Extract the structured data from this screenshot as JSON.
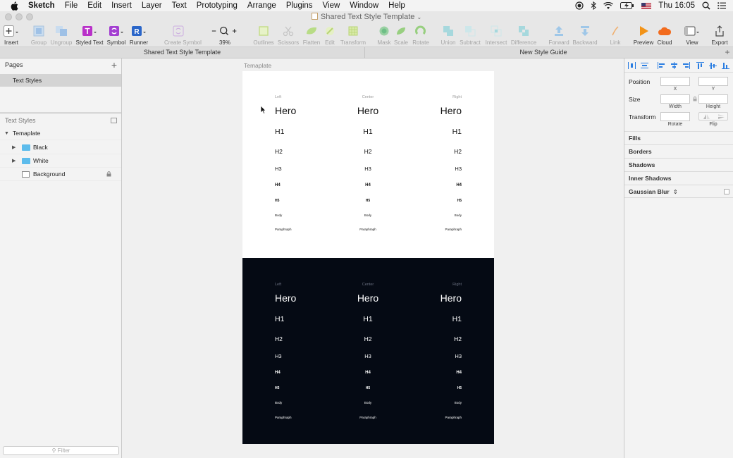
{
  "menubar": {
    "app": "Sketch",
    "items": [
      "File",
      "Edit",
      "Insert",
      "Layer",
      "Text",
      "Prototyping",
      "Arrange",
      "Plugins",
      "View",
      "Window",
      "Help"
    ],
    "clock": "Thu 16:05"
  },
  "window": {
    "title": "Shared Text Style Template"
  },
  "toolbar": {
    "insert": "Insert",
    "group": "Group",
    "ungroup": "Ungroup",
    "styled_text": "Styled Text",
    "symbol": "Symbol",
    "runner": "Runner",
    "create_symbol": "Create Symbol",
    "zoom": "39%",
    "outlines": "Outlines",
    "scissors": "Scissors",
    "flatten": "Flatten",
    "edit": "Edit",
    "transform": "Transform",
    "mask": "Mask",
    "scale": "Scale",
    "rotate": "Rotate",
    "union": "Union",
    "subtract": "Subtract",
    "intersect": "Intersect",
    "difference": "Difference",
    "forward": "Forward",
    "backward": "Backward",
    "link": "Link",
    "preview": "Preview",
    "cloud": "Cloud",
    "view": "View",
    "export": "Export"
  },
  "tabs": [
    "Shared Text Style Template",
    "New Style Guide"
  ],
  "sidebar": {
    "pages_title": "Pages",
    "page_item": "Text Styles",
    "layers_title": "Text Styles",
    "layers": [
      "Temaplate",
      "Black",
      "White",
      "Background"
    ],
    "filter_placeholder": "Filter"
  },
  "canvas": {
    "artboard_name": "Temaplate",
    "column_headers": [
      "Left",
      "Center",
      "Right"
    ],
    "styles": [
      "Hero",
      "H1",
      "H2",
      "H3",
      "H4",
      "H5",
      "Body",
      "Paraphraph"
    ],
    "colors": {
      "light_board": "#ffffff",
      "dark_board": "#050a14"
    }
  },
  "inspector": {
    "position": "Position",
    "x": "X",
    "y": "Y",
    "size": "Size",
    "width": "Width",
    "height": "Height",
    "transform": "Transform",
    "rotate": "Rotate",
    "flip": "Flip",
    "sections": [
      "Fills",
      "Borders",
      "Shadows",
      "Inner Shadows",
      "Gaussian Blur"
    ]
  }
}
